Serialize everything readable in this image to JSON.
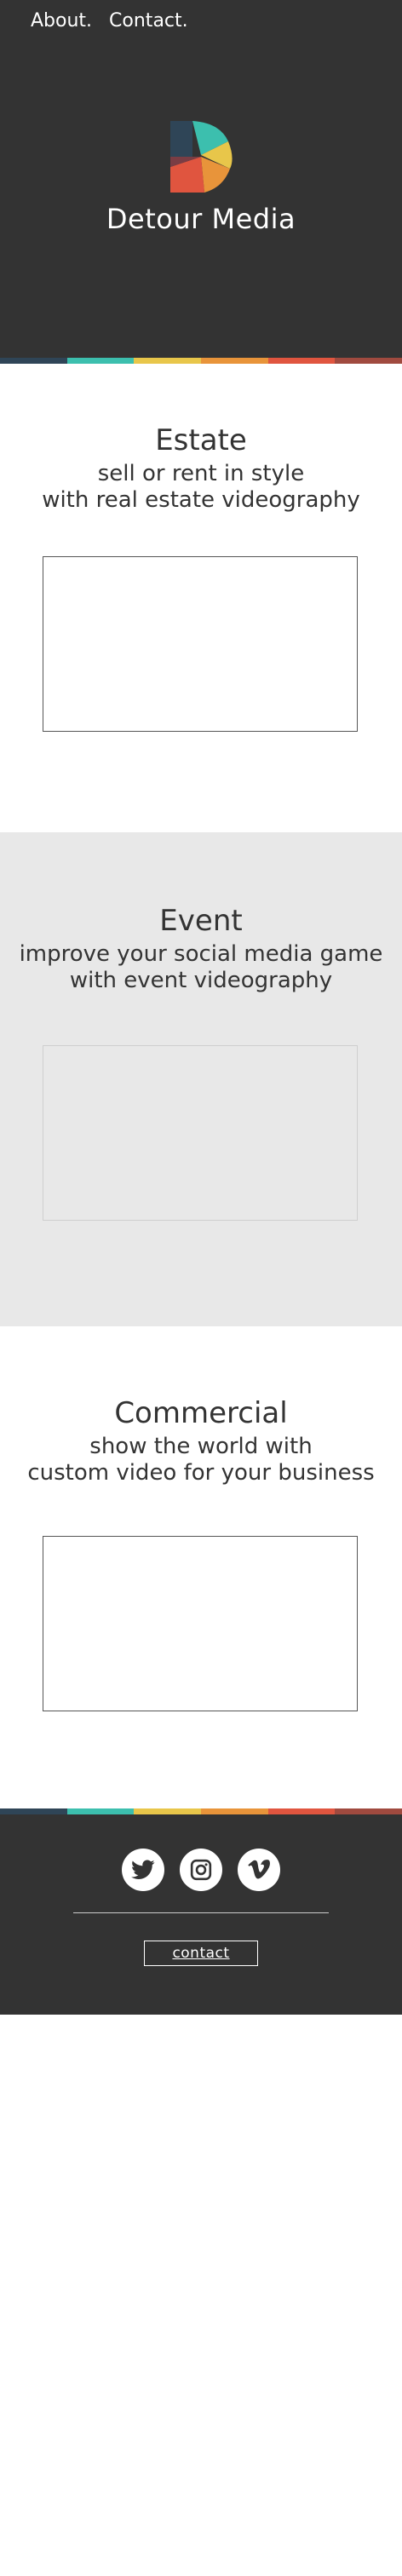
{
  "nav": {
    "about": "About.",
    "contact": "Contact."
  },
  "brand": {
    "name": "Detour Media",
    "logo_icon": "aperture-d-logo-icon"
  },
  "stripe_colors": [
    "#2f4557",
    "#3cbfae",
    "#e8c64a",
    "#e8943a",
    "#e0553f",
    "#a04a3f"
  ],
  "sections": [
    {
      "title": "Estate",
      "line1": "sell or rent in style",
      "line2": "with real estate videography"
    },
    {
      "title": "Event",
      "line1": "improve your social media game",
      "line2": "with event videography"
    },
    {
      "title": "Commercial",
      "line1": "show the world with",
      "line2": "custom video for your business"
    }
  ],
  "footer": {
    "social_icons": [
      "twitter-icon",
      "instagram-icon",
      "vimeo-icon"
    ],
    "contact_label": "contact"
  },
  "colors": {
    "dark": "#333333",
    "light_gray": "#e8e8e8",
    "white": "#ffffff"
  }
}
